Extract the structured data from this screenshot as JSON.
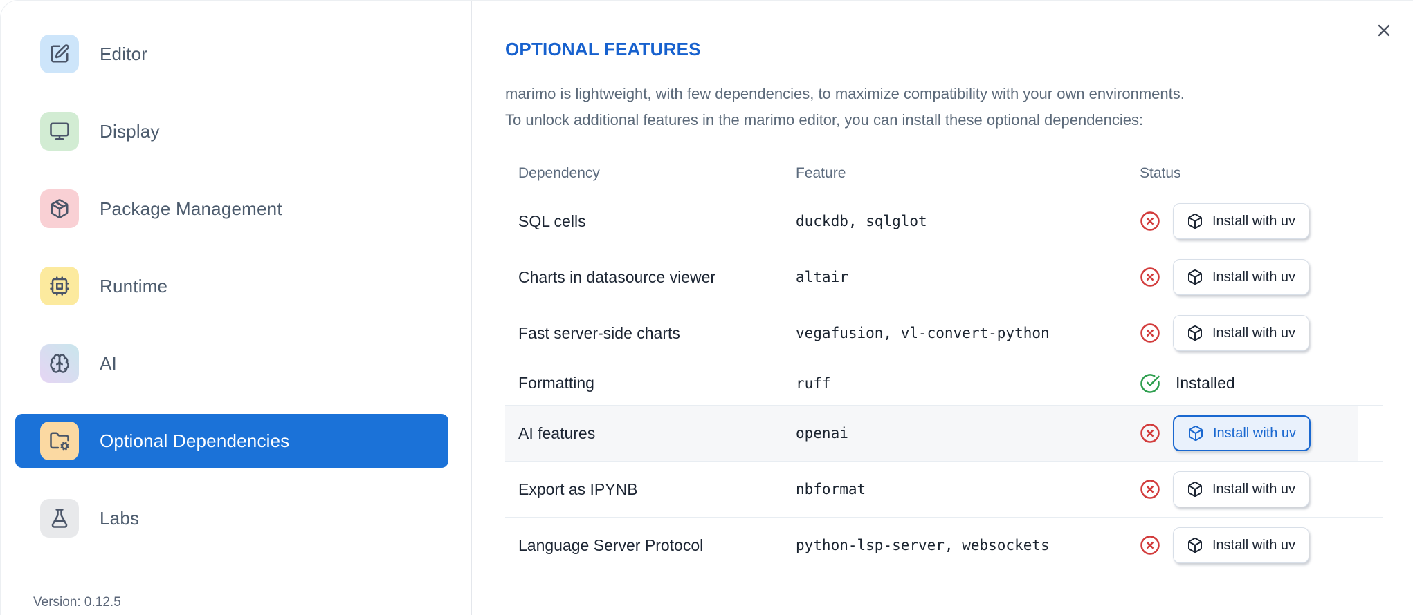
{
  "colors": {
    "accent_blue": "#1b72d8",
    "button_active_blue": "#1a68d0",
    "title_blue": "#1761ce",
    "error_red": "#d23b3b",
    "success_green": "#2d9e4e",
    "sidebar_label": "#4d5c6e"
  },
  "sidebar": {
    "items": [
      {
        "label": "Editor",
        "icon": "square-pen-icon",
        "icon_bg": "#cde5fa",
        "selected": false
      },
      {
        "label": "Display",
        "icon": "monitor-icon",
        "icon_bg": "#d2ecd3",
        "selected": false
      },
      {
        "label": "Package Management",
        "icon": "package-icon",
        "icon_bg": "#f9d0d4",
        "selected": false
      },
      {
        "label": "Runtime",
        "icon": "cpu-icon",
        "icon_bg": "#fcea9e",
        "selected": false
      },
      {
        "label": "AI",
        "icon": "brain-icon",
        "icon_bg_gradient": [
          "#c9e6ec",
          "#e6d5f4"
        ],
        "selected": false
      },
      {
        "label": "Optional Dependencies",
        "icon": "folder-cog-icon",
        "icon_bg": "#fbd9a2",
        "selected": true
      },
      {
        "label": "Labs",
        "icon": "flask-icon",
        "icon_bg": "#e8e9eb",
        "selected": false
      }
    ],
    "version_label": "Version: 0.12.5"
  },
  "panel": {
    "title": "OPTIONAL FEATURES",
    "description_lines": [
      "marimo is lightweight, with few dependencies, to maximize compatibility with your own environments.",
      "To unlock additional features in the marimo editor, you can install these optional dependencies:"
    ],
    "close_icon": "x-icon",
    "table": {
      "headers": [
        "Dependency",
        "Feature",
        "Status"
      ],
      "install_button_label": "Install with uv",
      "install_button_icon": "box-icon",
      "installed_label": "Installed",
      "status_icons": {
        "missing": "circle-x-icon",
        "installed": "circle-check-icon"
      },
      "rows": [
        {
          "dependency": "SQL cells",
          "feature": "duckdb, sqlglot",
          "status": "missing",
          "highlighted": false
        },
        {
          "dependency": "Charts in datasource viewer",
          "feature": "altair",
          "status": "missing",
          "highlighted": false
        },
        {
          "dependency": "Fast server-side charts",
          "feature": "vegafusion, vl-convert-python",
          "status": "missing",
          "highlighted": false
        },
        {
          "dependency": "Formatting",
          "feature": "ruff",
          "status": "installed",
          "highlighted": false
        },
        {
          "dependency": "AI features",
          "feature": "openai",
          "status": "missing",
          "highlighted": true
        },
        {
          "dependency": "Export as IPYNB",
          "feature": "nbformat",
          "status": "missing",
          "highlighted": false
        },
        {
          "dependency": "Language Server Protocol",
          "feature": "python-lsp-server, websockets",
          "status": "missing",
          "highlighted": false
        }
      ]
    }
  }
}
